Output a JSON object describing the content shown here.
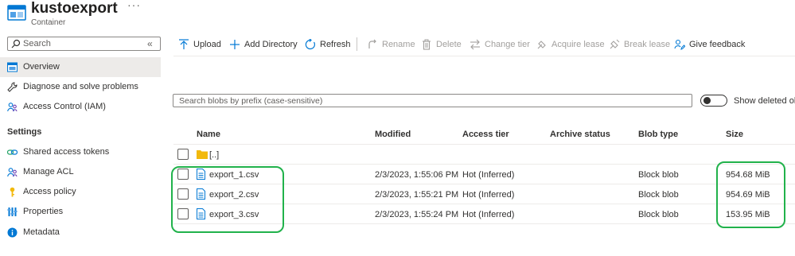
{
  "header": {
    "title": "kustoexport",
    "subtitle": "Container",
    "more": "···"
  },
  "sidebar": {
    "search_placeholder": "Search",
    "collapse_glyph": "«",
    "items_top": [
      {
        "label": "Overview",
        "icon": "overview-icon",
        "active": true
      },
      {
        "label": "Diagnose and solve problems",
        "icon": "wrench-icon"
      },
      {
        "label": "Access Control (IAM)",
        "icon": "people-icon"
      }
    ],
    "settings_heading": "Settings",
    "items_settings": [
      {
        "label": "Shared access tokens",
        "icon": "link-icon"
      },
      {
        "label": "Manage ACL",
        "icon": "people-icon"
      },
      {
        "label": "Access policy",
        "icon": "key-icon"
      },
      {
        "label": "Properties",
        "icon": "properties-icon"
      },
      {
        "label": "Metadata",
        "icon": "info-icon"
      }
    ]
  },
  "toolbar": {
    "upload": "Upload",
    "add_directory": "Add Directory",
    "refresh": "Refresh",
    "rename": "Rename",
    "delete": "Delete",
    "change_tier": "Change tier",
    "acquire_lease": "Acquire lease",
    "break_lease": "Break lease",
    "give_feedback": "Give feedback"
  },
  "filter": {
    "search_placeholder": "Search blobs by prefix (case-sensitive)",
    "show_deleted_label": "Show deleted objects",
    "show_deleted_on": false
  },
  "table": {
    "columns": [
      "Name",
      "Modified",
      "Access tier",
      "Archive status",
      "Blob type",
      "Size"
    ],
    "parent_row": "[..]",
    "rows": [
      {
        "name": "export_1.csv",
        "modified": "2/3/2023, 1:55:06 PM",
        "tier": "Hot (Inferred)",
        "archive": "",
        "type": "Block blob",
        "size": "954.68 MiB"
      },
      {
        "name": "export_2.csv",
        "modified": "2/3/2023, 1:55:21 PM",
        "tier": "Hot (Inferred)",
        "archive": "",
        "type": "Block blob",
        "size": "954.69 MiB"
      },
      {
        "name": "export_3.csv",
        "modified": "2/3/2023, 1:55:24 PM",
        "tier": "Hot (Inferred)",
        "archive": "",
        "type": "Block blob",
        "size": "153.95 MiB"
      }
    ]
  },
  "colors": {
    "accent": "#0078d4",
    "highlight": "#21b24b",
    "folder": "#f2b90c"
  }
}
